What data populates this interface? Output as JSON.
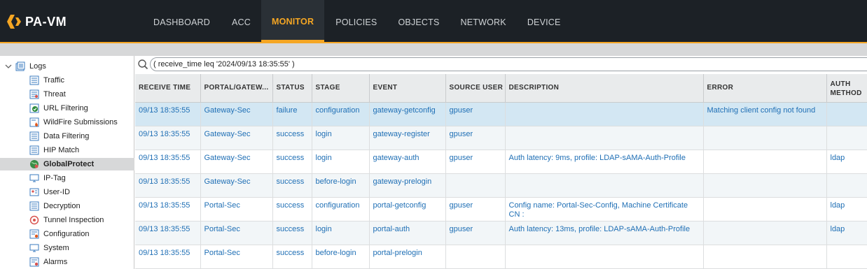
{
  "app": {
    "name": "PA-VM"
  },
  "nav": {
    "tabs": [
      {
        "label": "DASHBOARD"
      },
      {
        "label": "ACC"
      },
      {
        "label": "MONITOR"
      },
      {
        "label": "POLICIES"
      },
      {
        "label": "OBJECTS"
      },
      {
        "label": "NETWORK"
      },
      {
        "label": "DEVICE"
      }
    ],
    "active": "MONITOR",
    "accent": "#f5a623"
  },
  "sidebar": {
    "root": "Logs",
    "items": [
      {
        "label": "Traffic",
        "icon": "traffic-log-icon"
      },
      {
        "label": "Threat",
        "icon": "threat-log-icon"
      },
      {
        "label": "URL Filtering",
        "icon": "url-filtering-icon"
      },
      {
        "label": "WildFire Submissions",
        "icon": "wildfire-icon"
      },
      {
        "label": "Data Filtering",
        "icon": "data-filtering-icon"
      },
      {
        "label": "HIP Match",
        "icon": "hip-match-icon"
      },
      {
        "label": "GlobalProtect",
        "icon": "globalprotect-icon"
      },
      {
        "label": "IP-Tag",
        "icon": "ip-tag-icon"
      },
      {
        "label": "User-ID",
        "icon": "user-id-icon"
      },
      {
        "label": "Decryption",
        "icon": "decryption-icon"
      },
      {
        "label": "Tunnel Inspection",
        "icon": "tunnel-inspection-icon"
      },
      {
        "label": "Configuration",
        "icon": "configuration-icon"
      },
      {
        "label": "System",
        "icon": "system-icon"
      },
      {
        "label": "Alarms",
        "icon": "alarms-icon"
      }
    ],
    "selected": "GlobalProtect"
  },
  "filter": {
    "value": "( receive_time leq '2024/09/13 18:35:55' )"
  },
  "table": {
    "columns": [
      "RECEIVE TIME",
      "PORTAL/GATEW...",
      "STATUS",
      "STAGE",
      "EVENT",
      "SOURCE USER",
      "DESCRIPTION",
      "ERROR",
      "AUTH METHOD"
    ],
    "rows": [
      [
        "09/13 18:35:55",
        "Gateway-Sec",
        "failure",
        "configuration",
        "gateway-getconfig",
        "gpuser",
        "",
        "Matching client config not found",
        ""
      ],
      [
        "09/13 18:35:55",
        "Gateway-Sec",
        "success",
        "login",
        "gateway-register",
        "gpuser",
        "",
        "",
        ""
      ],
      [
        "09/13 18:35:55",
        "Gateway-Sec",
        "success",
        "login",
        "gateway-auth",
        "gpuser",
        "Auth latency: 9ms, profile: LDAP-sAMA-Auth-Profile",
        "",
        "ldap"
      ],
      [
        "09/13 18:35:55",
        "Gateway-Sec",
        "success",
        "before-login",
        "gateway-prelogin",
        "",
        "",
        "",
        ""
      ],
      [
        "09/13 18:35:55",
        "Portal-Sec",
        "success",
        "configuration",
        "portal-getconfig",
        "gpuser",
        "Config name: Portal-Sec-Config, Machine Certificate CN :",
        "",
        "ldap"
      ],
      [
        "09/13 18:35:55",
        "Portal-Sec",
        "success",
        "login",
        "portal-auth",
        "gpuser",
        "Auth latency: 13ms, profile: LDAP-sAMA-Auth-Profile",
        "",
        "ldap"
      ],
      [
        "09/13 18:35:55",
        "Portal-Sec",
        "success",
        "before-login",
        "portal-prelogin",
        "",
        "",
        "",
        ""
      ]
    ]
  }
}
